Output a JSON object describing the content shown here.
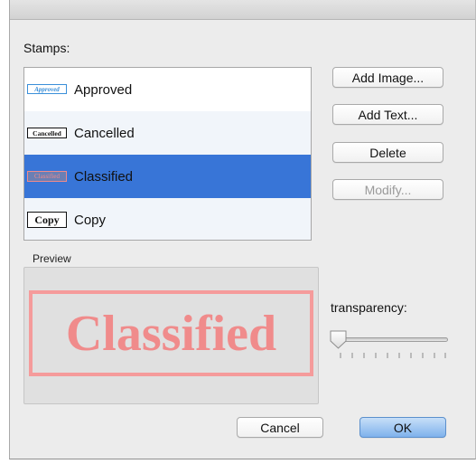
{
  "dialog": {
    "stamps_label": "Stamps:",
    "preview_label": "Preview",
    "transparency_label": "transparency:"
  },
  "stamps": [
    {
      "label": "Approved",
      "thumb_text": "Approved",
      "state": "normal"
    },
    {
      "label": "Cancelled",
      "thumb_text": "Cancelled",
      "state": "alternate"
    },
    {
      "label": "Classified",
      "thumb_text": "Classified",
      "state": "selected"
    },
    {
      "label": "Copy",
      "thumb_text": "Copy",
      "state": "alternate"
    }
  ],
  "buttons": {
    "add_image": "Add Image...",
    "add_text": "Add Text...",
    "delete": "Delete",
    "modify": "Modify...",
    "cancel": "Cancel",
    "ok": "OK"
  },
  "preview": {
    "stamp_text": "Classified",
    "stamp_color": "#f08b8b"
  },
  "transparency": {
    "value_fraction": 0.0
  },
  "colors": {
    "selection": "#3875d7",
    "ok_button": "#7fb2ec"
  }
}
